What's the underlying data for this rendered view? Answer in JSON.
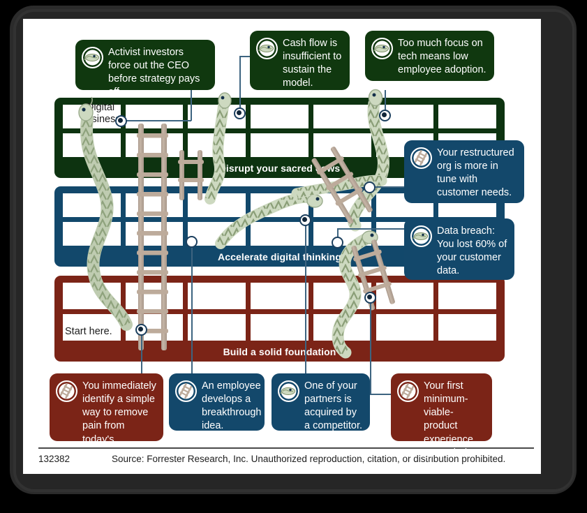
{
  "board": {
    "bands": [
      {
        "id": "disrupt",
        "label": "Disrupt your sacred cows",
        "color": "#0d3310"
      },
      {
        "id": "accelerate",
        "label": "Accelerate digital thinking",
        "color": "#12486b"
      },
      {
        "id": "foundation",
        "label": "Build a solid foundation",
        "color": "#7b2417"
      }
    ],
    "notes": [
      {
        "id": "goal",
        "text": "Digital business"
      },
      {
        "id": "start",
        "text": "Start here."
      }
    ]
  },
  "callouts": [
    {
      "id": "activist-investors",
      "text": "Activist investors force out the CEO before strategy pays off.",
      "icon": "snake-icon",
      "color": "green"
    },
    {
      "id": "cash-flow",
      "text": "Cash flow is insufficient to sustain the model.",
      "icon": "snake-icon",
      "color": "green"
    },
    {
      "id": "tech-focus",
      "text": "Too much focus on tech means low employee adoption.",
      "icon": "snake-icon",
      "color": "green"
    },
    {
      "id": "restructured-org",
      "text": "Your restructured org is more in tune with customer needs.",
      "icon": "ladder-icon",
      "color": "navy"
    },
    {
      "id": "data-breach",
      "text": "Data breach: You lost 60% of your customer data.",
      "icon": "snake-icon",
      "color": "navy"
    },
    {
      "id": "remove-pain",
      "text": "You immediately identify a simple way to remove pain from today's customer journey.",
      "icon": "ladder-icon",
      "color": "red"
    },
    {
      "id": "breakthrough-idea",
      "text": "An employee develops a breakthrough idea.",
      "icon": "ladder-icon",
      "color": "navy"
    },
    {
      "id": "partner-acquired",
      "text": "One of your partners is acquired by a competitor.",
      "icon": "snake-icon",
      "color": "navy"
    },
    {
      "id": "mvp-viral",
      "text": "Your first minimum-viable-product experience goes viral.",
      "icon": "ladder-icon",
      "color": "red"
    }
  ],
  "footer": {
    "id": "132382",
    "source": "Source: Forrester Research, Inc. Unauthorized reproduction, citation, or distribution prohibited."
  },
  "colors": {
    "green": "#0d3310",
    "navy": "#12486b",
    "red": "#7b2417",
    "snake_body": "#cdd9c0",
    "snake_pattern": "#8a9e77",
    "ladder": "#bdab9b",
    "connector": "#3d6480"
  }
}
